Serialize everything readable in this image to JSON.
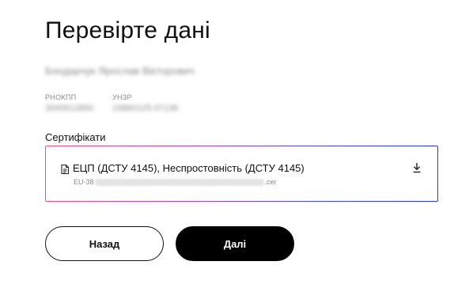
{
  "page": {
    "title": "Перевірте дані"
  },
  "person": {
    "full_name": "Бондарчук Ярослав Вікторович",
    "rnokpp_label": "РНОКПП",
    "rnokpp_value": "3045612850",
    "unzr_label": "УНЗР",
    "unzr_value": "19860125-07136"
  },
  "certificates": {
    "label": "Сертифікати",
    "items": [
      {
        "name": "ЕЦП (ДСТУ 4145), Неспростовність (ДСТУ 4145)",
        "file_prefix": "EU-38",
        "file_suffix": ".cer",
        "icon": "document-icon",
        "action_icon": "download-icon"
      }
    ]
  },
  "actions": {
    "back_label": "Назад",
    "next_label": "Далі"
  },
  "colors": {
    "button_primary_bg": "#000000",
    "border_gradient_start": "#e8558a",
    "border_gradient_end": "#2a3ad8",
    "muted_text": "#8c8c8c"
  }
}
